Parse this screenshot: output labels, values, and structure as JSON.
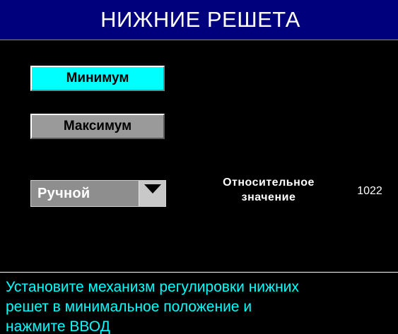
{
  "header": {
    "title": "НИЖНИЕ РЕШЕТА"
  },
  "buttons": {
    "minimum_label": "Минимум",
    "maximum_label": "Максимум"
  },
  "mode_select": {
    "selected": "Ручной",
    "arrow_icon": "triangle-down-icon"
  },
  "relative_value": {
    "label": "Относительное\nзначение",
    "value": "1022"
  },
  "message": {
    "text": "Установите механизм регулировки нижних\nрешет в минимальное положение и\nнажмите ВВОД"
  },
  "colors": {
    "title_bar": "#00007d",
    "active_button": "#00ffff",
    "inactive_button": "#9a9a9a",
    "message_text": "#00ffff",
    "background": "#000000"
  }
}
